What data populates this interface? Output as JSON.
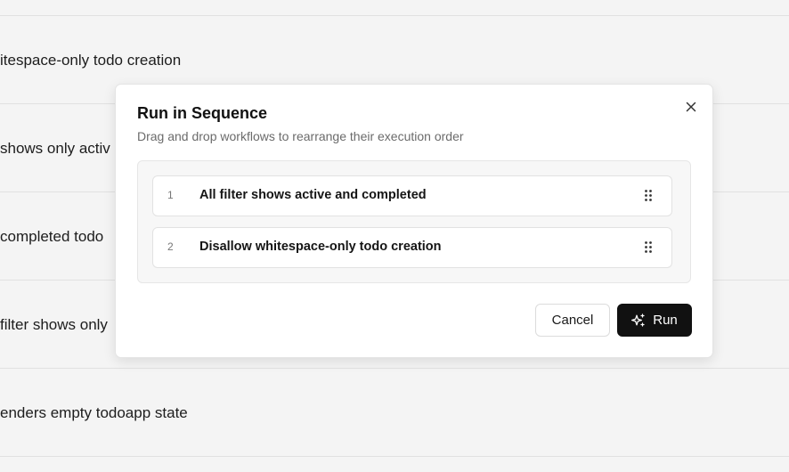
{
  "background": {
    "rows": [
      "itespace-only todo creation",
      "shows only activ",
      "completed todo",
      "filter shows only",
      "enders empty todoapp state"
    ]
  },
  "modal": {
    "title": "Run in Sequence",
    "subtitle": "Drag and drop workflows to rearrange their execution order",
    "close_icon": "close-icon",
    "items": [
      {
        "number": "1",
        "label": "All filter shows active and completed",
        "icon": "drag-handle-icon"
      },
      {
        "number": "2",
        "label": "Disallow whitespace-only todo creation",
        "icon": "drag-handle-icon"
      }
    ],
    "cancel_label": "Cancel",
    "run_label": "Run",
    "run_icon": "sparkles-icon"
  },
  "colors": {
    "primary_button": "#111111",
    "modal_background": "#ffffff",
    "list_background": "#f7f7f7"
  }
}
